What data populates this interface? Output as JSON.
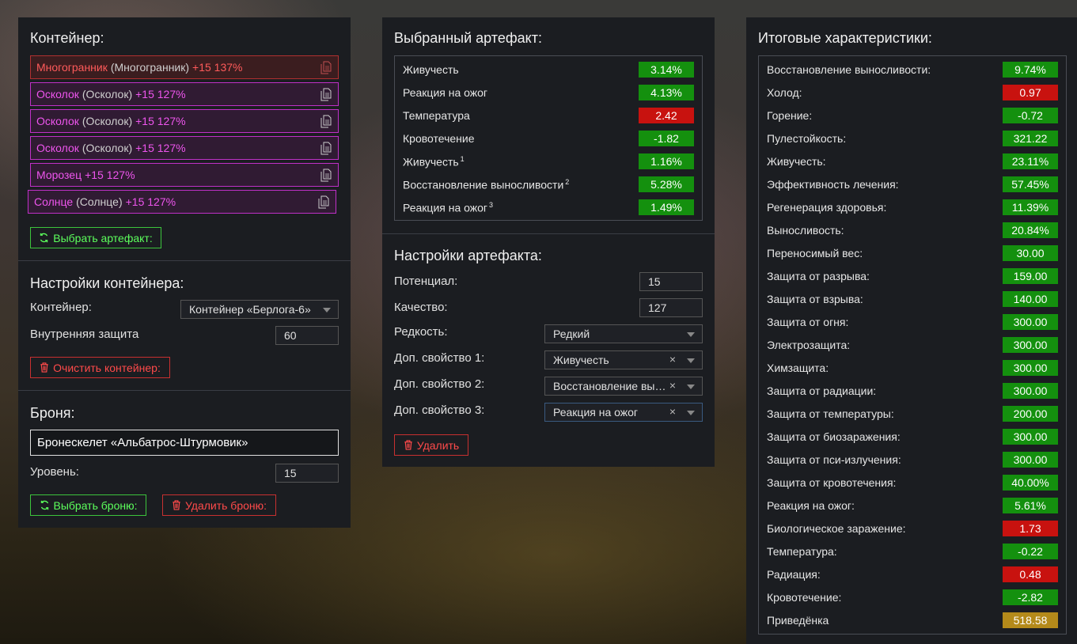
{
  "container_panel": {
    "title": "Контейнер:",
    "artifacts": [
      {
        "name": "Многогранник",
        "alias": "(Многогранник)",
        "level": "+15 137%",
        "color": "red"
      },
      {
        "name": "Осколок",
        "alias": "(Осколок)",
        "level": "+15 127%",
        "color": "purple"
      },
      {
        "name": "Осколок",
        "alias": "(Осколок)",
        "level": "+15 127%",
        "color": "purple"
      },
      {
        "name": "Осколок",
        "alias": "(Осколок)",
        "level": "+15 127%",
        "color": "purple"
      },
      {
        "name": "Морозец",
        "alias": "",
        "level": "+15 127%",
        "color": "purple"
      },
      {
        "name": "Солнце",
        "alias": "(Солнце)",
        "level": "+15 127%",
        "color": "purple"
      }
    ],
    "select_artifact_button": "Выбрать артефакт:",
    "settings_title": "Настройки контейнера:",
    "container_label": "Контейнер:",
    "container_value": "Контейнер «Берлога-6»",
    "inner_protection_label": "Внутренняя защита",
    "inner_protection_value": "60",
    "clear_button": "Очистить контейнер:",
    "armor_title": "Броня:",
    "armor_value": "Бронескелет «Альбатрос-Штурмовик»",
    "level_label": "Уровень:",
    "level_value": "15",
    "select_armor_button": "Выбрать броню:",
    "delete_armor_button": "Удалить броню:"
  },
  "selected_panel": {
    "title": "Выбранный артефакт:",
    "stats": [
      {
        "label": "Живучесть",
        "sup": "",
        "value": "3.14%",
        "color": "green"
      },
      {
        "label": "Реакция на ожог",
        "sup": "",
        "value": "4.13%",
        "color": "green"
      },
      {
        "label": "Температура",
        "sup": "",
        "value": "2.42",
        "color": "red"
      },
      {
        "label": "Кровотечение",
        "sup": "",
        "value": "-1.82",
        "color": "green"
      },
      {
        "label": "Живучесть",
        "sup": "1",
        "value": "1.16%",
        "color": "green"
      },
      {
        "label": "Восстановление выносливости",
        "sup": "2",
        "value": "5.28%",
        "color": "green"
      },
      {
        "label": "Реакция на ожог",
        "sup": "3",
        "value": "1.49%",
        "color": "green"
      }
    ],
    "settings_title": "Настройки артефакта:",
    "potential_label": "Потенциал:",
    "potential_value": "15",
    "quality_label": "Качество:",
    "quality_value": "127",
    "rarity_label": "Редкость:",
    "rarity_value": "Редкий",
    "extra1_label": "Доп. свойство 1:",
    "extra1_value": "Живучесть",
    "extra2_label": "Доп. свойство 2:",
    "extra2_value": "Восстановление выносливости",
    "extra3_label": "Доп. свойство 3:",
    "extra3_value": "Реакция на ожог",
    "clear_symbol": "×",
    "delete_button": "Удалить"
  },
  "totals_panel": {
    "title": "Итоговые характеристики:",
    "stats": [
      {
        "label": "Восстановление выносливости:",
        "value": "9.74%",
        "color": "green"
      },
      {
        "label": "Холод:",
        "value": "0.97",
        "color": "red"
      },
      {
        "label": "Горение:",
        "value": "-0.72",
        "color": "green"
      },
      {
        "label": "Пулестойкость:",
        "value": "321.22",
        "color": "green"
      },
      {
        "label": "Живучесть:",
        "value": "23.11%",
        "color": "green"
      },
      {
        "label": "Эффективность лечения:",
        "value": "57.45%",
        "color": "green"
      },
      {
        "label": "Регенерация здоровья:",
        "value": "11.39%",
        "color": "green"
      },
      {
        "label": "Выносливость:",
        "value": "20.84%",
        "color": "green"
      },
      {
        "label": "Переносимый вес:",
        "value": "30.00",
        "color": "green"
      },
      {
        "label": "Защита от разрыва:",
        "value": "159.00",
        "color": "green"
      },
      {
        "label": "Защита от взрыва:",
        "value": "140.00",
        "color": "green"
      },
      {
        "label": "Защита от огня:",
        "value": "300.00",
        "color": "green"
      },
      {
        "label": "Электрозащита:",
        "value": "300.00",
        "color": "green"
      },
      {
        "label": "Химзащита:",
        "value": "300.00",
        "color": "green"
      },
      {
        "label": "Защита от радиации:",
        "value": "300.00",
        "color": "green"
      },
      {
        "label": "Защита от температуры:",
        "value": "200.00",
        "color": "green"
      },
      {
        "label": "Защита от биозаражения:",
        "value": "300.00",
        "color": "green"
      },
      {
        "label": "Защита от пси-излучения:",
        "value": "300.00",
        "color": "green"
      },
      {
        "label": "Защита от кровотечения:",
        "value": "40.00%",
        "color": "green"
      },
      {
        "label": "Реакция на ожог:",
        "value": "5.61%",
        "color": "green"
      },
      {
        "label": "Биологическое заражение:",
        "value": "1.73",
        "color": "red"
      },
      {
        "label": "Температура:",
        "value": "-0.22",
        "color": "green"
      },
      {
        "label": "Радиация:",
        "value": "0.48",
        "color": "red"
      },
      {
        "label": "Кровотечение:",
        "value": "-2.82",
        "color": "green"
      },
      {
        "label": "Приведёнка",
        "value": "518.58",
        "color": "gold"
      }
    ]
  },
  "icons": {
    "copy": "copy-icon",
    "refresh": "refresh-icon",
    "trash": "trash-icon",
    "chevron": "chevron-down-icon"
  },
  "colors": {
    "green": "#14900e",
    "red": "#c8120f",
    "gold": "#b48a1a",
    "purple_border": "#c030c8",
    "red_border": "#b03030"
  }
}
